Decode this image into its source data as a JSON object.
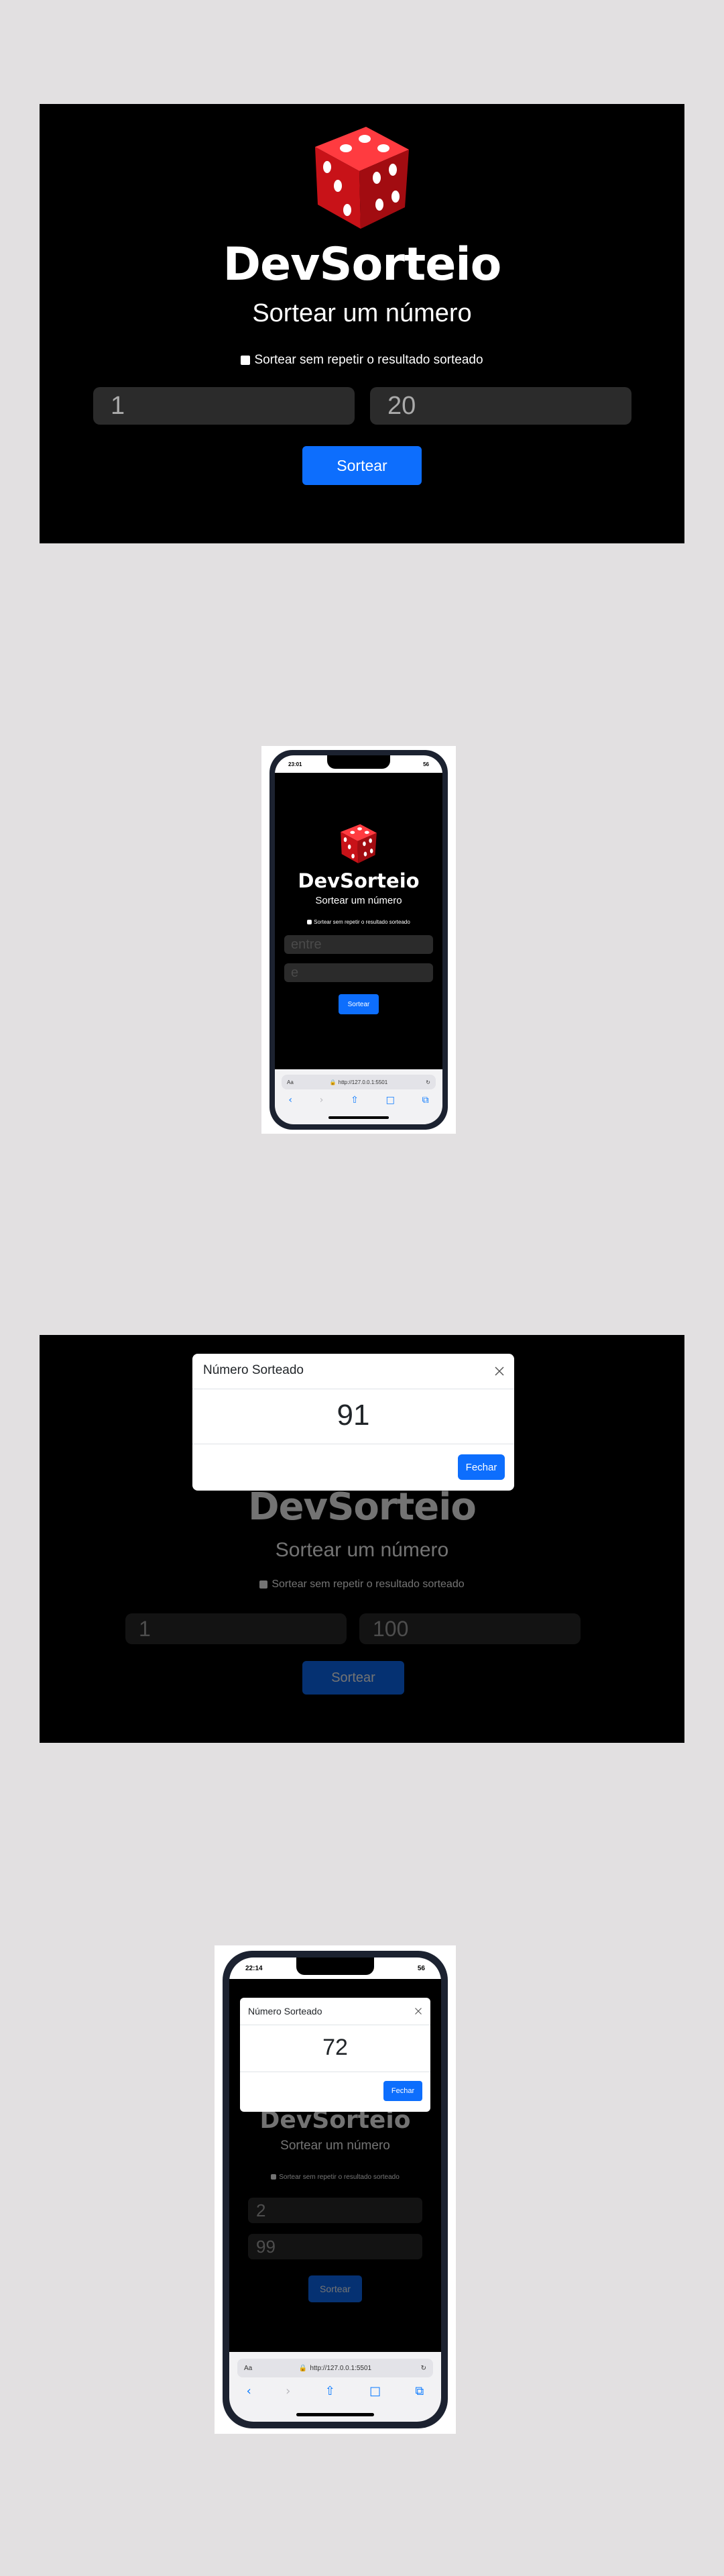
{
  "app": {
    "title": "DevSorteio",
    "subtitle": "Sortear um número",
    "checkbox_label": "Sortear sem repetir o resultado sorteado",
    "button_label": "Sortear",
    "placeholder_min": "entre",
    "placeholder_max": "e"
  },
  "shot1": {
    "min_value": "1",
    "max_value": "20"
  },
  "shot3": {
    "modal_title": "Número Sorteado",
    "result": "91",
    "close_label": "Fechar",
    "min_value": "1",
    "max_value": "100"
  },
  "phone1": {
    "time": "23:01",
    "battery": "56",
    "url_prefix": "Aa",
    "url": "http://127.0.0.1:5501"
  },
  "phone2": {
    "time": "22:14",
    "battery": "56",
    "url_prefix": "Aa",
    "url": "http://127.0.0.1:5501",
    "modal_title": "Número Sorteado",
    "result": "72",
    "close_label": "Fechar",
    "min_value": "2",
    "max_value": "99"
  },
  "icons": [
    "dice-icon",
    "close-icon",
    "back-icon",
    "forward-icon",
    "share-icon",
    "book-icon",
    "tabs-icon",
    "reload-icon",
    "lock-icon"
  ],
  "colors": {
    "accent": "#0d6efd",
    "background": "#000000",
    "dice": "#d8141b",
    "page": "#e2e0e1"
  }
}
